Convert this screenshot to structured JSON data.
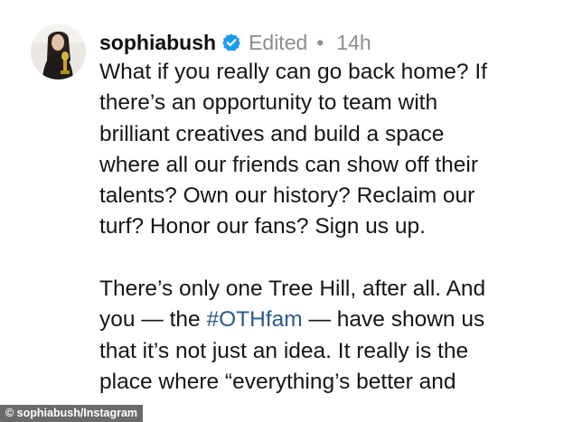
{
  "post": {
    "username": "sophiabush",
    "edited_label": "Edited",
    "separator": "•",
    "time": "14h",
    "caption_lines": [
      "What if you really can go back home? If",
      "there’s an opportunity to team with",
      "brilliant creatives and build a space",
      "where all our friends can show off their",
      "talents? Own our history? Reclaim our",
      "turf? Honor our fans? Sign us up.",
      "",
      "There’s only one Tree Hill, after all. And",
      "you — the ",
      "#OTHfam",
      " — have shown us",
      "that it’s not just an idea. It really is the",
      "place where “everything’s better and"
    ]
  },
  "icons": {
    "verified": "verified-badge-icon",
    "avatar": "profile-avatar"
  },
  "colors": {
    "hashtag": "#2a5a8c",
    "verified": "#1d9bf0",
    "meta_text": "#8e8e8e"
  },
  "credit": "© sophiabush/Instagram"
}
